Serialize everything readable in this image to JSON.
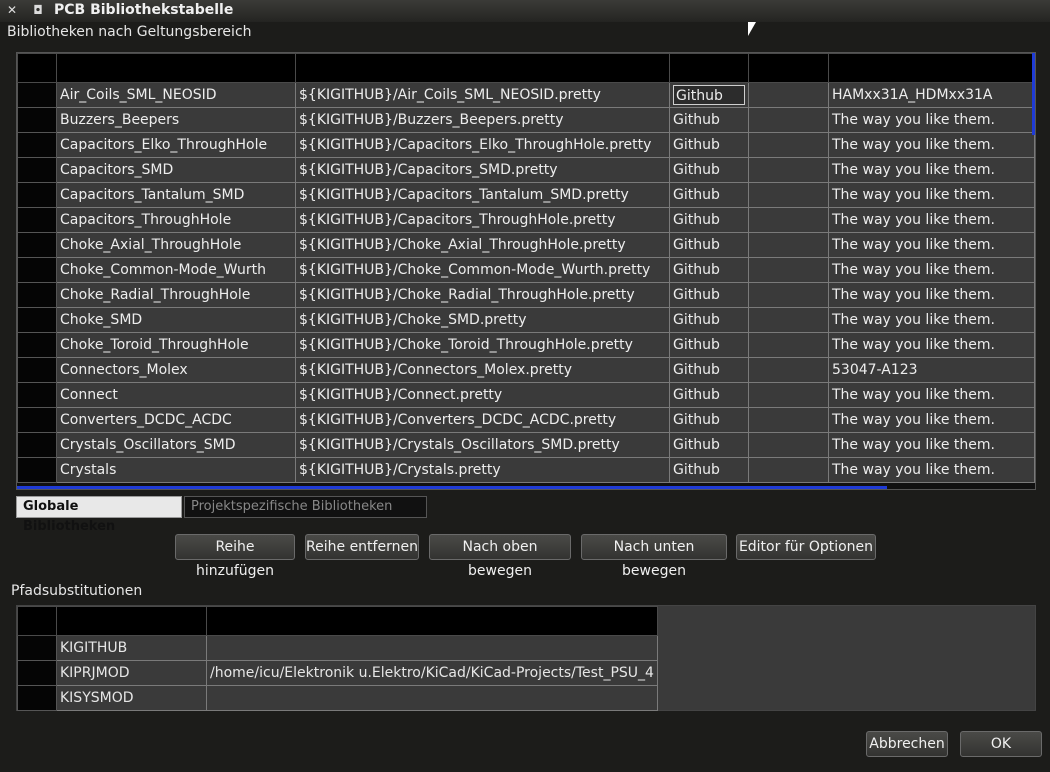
{
  "window": {
    "title": "PCB Bibliothekstabelle"
  },
  "scope_label": "Bibliotheken nach Geltungsbereich",
  "libraries": [
    {
      "name": "Air_Coils_SML_NEOSID",
      "uri": "${KIGITHUB}/Air_Coils_SML_NEOSID.pretty",
      "type": "Github",
      "desc": "HAMxx31A_HDMxx31A"
    },
    {
      "name": "Buzzers_Beepers",
      "uri": "${KIGITHUB}/Buzzers_Beepers.pretty",
      "type": "Github",
      "desc": "The way you like them."
    },
    {
      "name": "Capacitors_Elko_ThroughHole",
      "uri": "${KIGITHUB}/Capacitors_Elko_ThroughHole.pretty",
      "type": "Github",
      "desc": "The way you like them."
    },
    {
      "name": "Capacitors_SMD",
      "uri": "${KIGITHUB}/Capacitors_SMD.pretty",
      "type": "Github",
      "desc": "The way you like them."
    },
    {
      "name": "Capacitors_Tantalum_SMD",
      "uri": "${KIGITHUB}/Capacitors_Tantalum_SMD.pretty",
      "type": "Github",
      "desc": "The way you like them."
    },
    {
      "name": "Capacitors_ThroughHole",
      "uri": "${KIGITHUB}/Capacitors_ThroughHole.pretty",
      "type": "Github",
      "desc": "The way you like them."
    },
    {
      "name": "Choke_Axial_ThroughHole",
      "uri": "${KIGITHUB}/Choke_Axial_ThroughHole.pretty",
      "type": "Github",
      "desc": "The way you like them."
    },
    {
      "name": "Choke_Common-Mode_Wurth",
      "uri": "${KIGITHUB}/Choke_Common-Mode_Wurth.pretty",
      "type": "Github",
      "desc": "The way you like them."
    },
    {
      "name": "Choke_Radial_ThroughHole",
      "uri": "${KIGITHUB}/Choke_Radial_ThroughHole.pretty",
      "type": "Github",
      "desc": "The way you like them."
    },
    {
      "name": "Choke_SMD",
      "uri": "${KIGITHUB}/Choke_SMD.pretty",
      "type": "Github",
      "desc": "The way you like them."
    },
    {
      "name": "Choke_Toroid_ThroughHole",
      "uri": "${KIGITHUB}/Choke_Toroid_ThroughHole.pretty",
      "type": "Github",
      "desc": "The way you like them."
    },
    {
      "name": "Connectors_Molex",
      "uri": "${KIGITHUB}/Connectors_Molex.pretty",
      "type": "Github",
      "desc": "53047-A123"
    },
    {
      "name": "Connect",
      "uri": "${KIGITHUB}/Connect.pretty",
      "type": "Github",
      "desc": "The way you like them."
    },
    {
      "name": "Converters_DCDC_ACDC",
      "uri": "${KIGITHUB}/Converters_DCDC_ACDC.pretty",
      "type": "Github",
      "desc": "The way you like them."
    },
    {
      "name": "Crystals_Oscillators_SMD",
      "uri": "${KIGITHUB}/Crystals_Oscillators_SMD.pretty",
      "type": "Github",
      "desc": "The way you like them."
    },
    {
      "name": "Crystals",
      "uri": "${KIGITHUB}/Crystals.pretty",
      "type": "Github",
      "desc": "The way you like them."
    }
  ],
  "tabs": {
    "global": "Globale Bibliotheken",
    "project": "Projektspezifische Bibliotheken"
  },
  "buttons": {
    "add_row": "Reihe hinzufügen",
    "remove_row": "Reihe entfernen",
    "move_up": "Nach oben bewegen",
    "move_down": "Nach unten bewegen",
    "options_editor": "Editor für Optionen",
    "cancel": "Abbrechen",
    "ok": "OK"
  },
  "path_subst_label": "Pfadsubstitutionen",
  "path_substitutions": [
    {
      "name": "KIGITHUB",
      "value": ""
    },
    {
      "name": "KIPRJMOD",
      "value": "/home/icu/Elektronik u.Elektro/KiCad/KiCad-Projects/Test_PSU_4"
    },
    {
      "name": "KISYSMOD",
      "value": ""
    }
  ]
}
